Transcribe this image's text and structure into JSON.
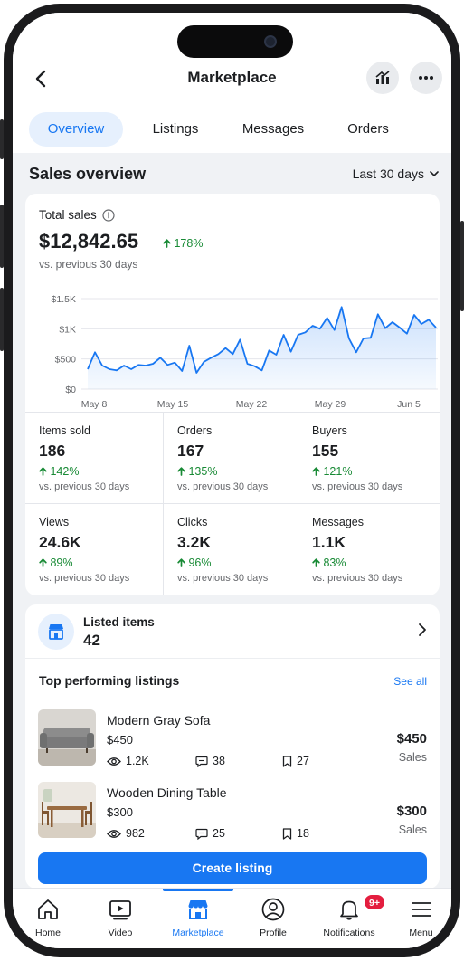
{
  "header": {
    "title": "Marketplace"
  },
  "tabs": [
    {
      "label": "Overview",
      "active": true
    },
    {
      "label": "Listings",
      "active": false
    },
    {
      "label": "Messages",
      "active": false
    },
    {
      "label": "Orders",
      "active": false
    }
  ],
  "sales_overview": {
    "heading": "Sales overview",
    "range": "Last 30 days",
    "total_label": "Total sales",
    "total_value": "$12,842.65",
    "total_delta": "178%",
    "total_compare": "vs. previous 30 days"
  },
  "chart_data": {
    "type": "area",
    "y_ticks": [
      "$1.5K",
      "$1K",
      "$500",
      "$0"
    ],
    "x_ticks": [
      "May 8",
      "May 15",
      "May 22",
      "May 29",
      "Jun 5"
    ],
    "ylim": [
      0,
      1500
    ],
    "grid": true,
    "series": [
      {
        "values": [
          330,
          610,
          390,
          330,
          310,
          390,
          330,
          400,
          390,
          420,
          520,
          400,
          440,
          300,
          720,
          270,
          450,
          520,
          580,
          680,
          580,
          820,
          420,
          380,
          310,
          640,
          570,
          900,
          620,
          900,
          940,
          1050,
          1000,
          1180,
          980,
          1360,
          840,
          610,
          840,
          850,
          1240,
          1010,
          1110,
          1020,
          920,
          1230,
          1080,
          1150,
          1020
        ]
      }
    ],
    "color": "#1877f2"
  },
  "stats": [
    {
      "label": "Items sold",
      "value": "186",
      "delta": "142%",
      "sub": "vs. previous 30 days"
    },
    {
      "label": "Orders",
      "value": "167",
      "delta": "135%",
      "sub": "vs. previous 30 days"
    },
    {
      "label": "Buyers",
      "value": "155",
      "delta": "121%",
      "sub": "vs. previous 30 days"
    },
    {
      "label": "Views",
      "value": "24.6K",
      "delta": "89%",
      "sub": "vs. previous 30 days"
    },
    {
      "label": "Clicks",
      "value": "3.2K",
      "delta": "96%",
      "sub": "vs. previous 30 days"
    },
    {
      "label": "Messages",
      "value": "1.1K",
      "delta": "83%",
      "sub": "vs. previous 30 days"
    }
  ],
  "listed_items": {
    "title": "Listed items",
    "count": "42"
  },
  "top_listings": {
    "title": "Top performing listings",
    "see_all": "See all",
    "items": [
      {
        "name": "Modern Gray Sofa",
        "price": "$450",
        "views": "1.2K",
        "messages": "38",
        "saves": "27",
        "sales_amount": "$450",
        "sales_label": "Sales"
      },
      {
        "name": "Wooden Dining Table",
        "price": "$300",
        "views": "982",
        "messages": "25",
        "saves": "18",
        "sales_amount": "$300",
        "sales_label": "Sales"
      }
    ]
  },
  "create_button": "Create listing",
  "nav": [
    {
      "label": "Home",
      "icon": "home-icon",
      "active": false
    },
    {
      "label": "Video",
      "icon": "video-icon",
      "active": false
    },
    {
      "label": "Marketplace",
      "icon": "marketplace-icon",
      "active": true
    },
    {
      "label": "Profile",
      "icon": "profile-icon",
      "active": false
    },
    {
      "label": "Notifications",
      "icon": "bell-icon",
      "active": false,
      "badge": "9+"
    },
    {
      "label": "Menu",
      "icon": "menu-icon",
      "active": false
    }
  ],
  "colors": {
    "accent": "#1877f2",
    "positive": "#188a35",
    "badge": "#e41e3f"
  }
}
